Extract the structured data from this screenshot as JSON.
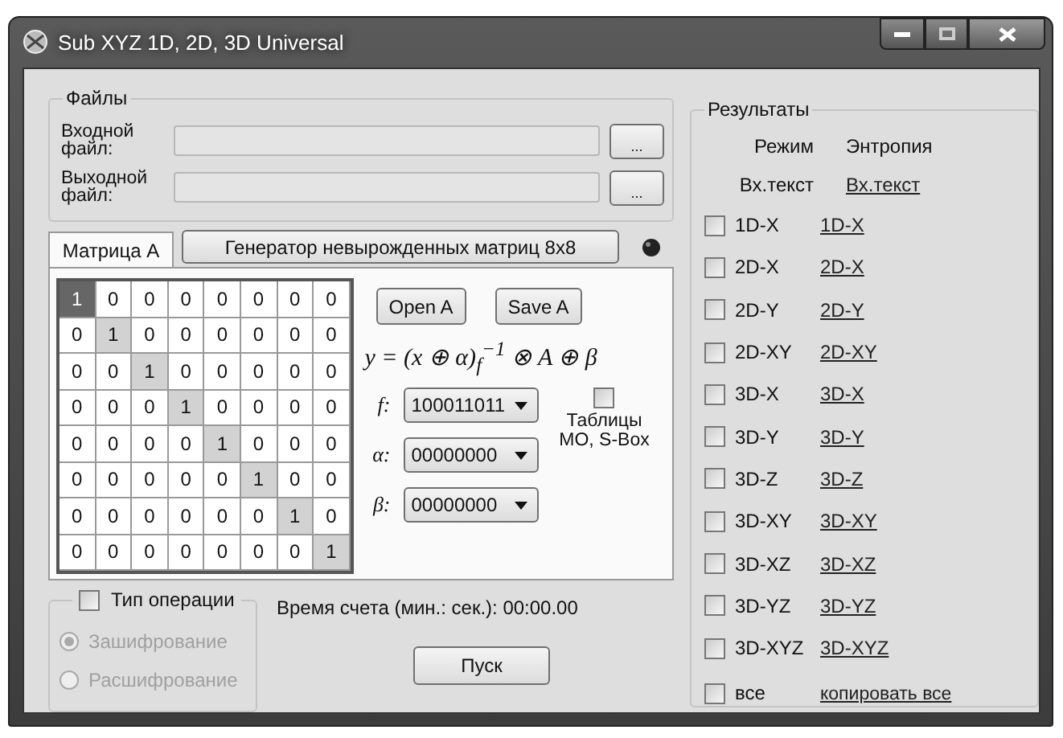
{
  "window": {
    "title": "Sub XYZ 1D, 2D, 3D Universal"
  },
  "files": {
    "title": "Файлы",
    "rows": [
      {
        "label": "Входной файл:",
        "browse": "..."
      },
      {
        "label": "Выходной файл:",
        "browse": "..."
      }
    ]
  },
  "tabs": [
    {
      "label": "Матрица А",
      "selected": true
    }
  ],
  "generator_button": "Генератор невырожденных матриц 8x8",
  "matrix": {
    "rows": [
      [
        {
          "value": "1",
          "selected": true,
          "marked": true
        },
        {
          "value": "0",
          "selected": false,
          "marked": false
        },
        {
          "value": "0",
          "selected": false,
          "marked": false
        },
        {
          "value": "0",
          "selected": false,
          "marked": false
        },
        {
          "value": "0",
          "selected": false,
          "marked": false
        },
        {
          "value": "0",
          "selected": false,
          "marked": false
        },
        {
          "value": "0",
          "selected": false,
          "marked": false
        },
        {
          "value": "0",
          "selected": false,
          "marked": false
        }
      ],
      [
        {
          "value": "0",
          "selected": false,
          "marked": false
        },
        {
          "value": "1",
          "selected": false,
          "marked": true
        },
        {
          "value": "0",
          "selected": false,
          "marked": false
        },
        {
          "value": "0",
          "selected": false,
          "marked": false
        },
        {
          "value": "0",
          "selected": false,
          "marked": false
        },
        {
          "value": "0",
          "selected": false,
          "marked": false
        },
        {
          "value": "0",
          "selected": false,
          "marked": false
        },
        {
          "value": "0",
          "selected": false,
          "marked": false
        }
      ],
      [
        {
          "value": "0",
          "selected": false,
          "marked": false
        },
        {
          "value": "0",
          "selected": false,
          "marked": false
        },
        {
          "value": "1",
          "selected": false,
          "marked": true
        },
        {
          "value": "0",
          "selected": false,
          "marked": false
        },
        {
          "value": "0",
          "selected": false,
          "marked": false
        },
        {
          "value": "0",
          "selected": false,
          "marked": false
        },
        {
          "value": "0",
          "selected": false,
          "marked": false
        },
        {
          "value": "0",
          "selected": false,
          "marked": false
        }
      ],
      [
        {
          "value": "0",
          "selected": false,
          "marked": false
        },
        {
          "value": "0",
          "selected": false,
          "marked": false
        },
        {
          "value": "0",
          "selected": false,
          "marked": false
        },
        {
          "value": "1",
          "selected": false,
          "marked": true
        },
        {
          "value": "0",
          "selected": false,
          "marked": false
        },
        {
          "value": "0",
          "selected": false,
          "marked": false
        },
        {
          "value": "0",
          "selected": false,
          "marked": false
        },
        {
          "value": "0",
          "selected": false,
          "marked": false
        }
      ],
      [
        {
          "value": "0",
          "selected": false,
          "marked": false
        },
        {
          "value": "0",
          "selected": false,
          "marked": false
        },
        {
          "value": "0",
          "selected": false,
          "marked": false
        },
        {
          "value": "0",
          "selected": false,
          "marked": false
        },
        {
          "value": "1",
          "selected": false,
          "marked": true
        },
        {
          "value": "0",
          "selected": false,
          "marked": false
        },
        {
          "value": "0",
          "selected": false,
          "marked": false
        },
        {
          "value": "0",
          "selected": false,
          "marked": false
        }
      ],
      [
        {
          "value": "0",
          "selected": false,
          "marked": false
        },
        {
          "value": "0",
          "selected": false,
          "marked": false
        },
        {
          "value": "0",
          "selected": false,
          "marked": false
        },
        {
          "value": "0",
          "selected": false,
          "marked": false
        },
        {
          "value": "0",
          "selected": false,
          "marked": false
        },
        {
          "value": "1",
          "selected": false,
          "marked": true
        },
        {
          "value": "0",
          "selected": false,
          "marked": false
        },
        {
          "value": "0",
          "selected": false,
          "marked": false
        }
      ],
      [
        {
          "value": "0",
          "selected": false,
          "marked": false
        },
        {
          "value": "0",
          "selected": false,
          "marked": false
        },
        {
          "value": "0",
          "selected": false,
          "marked": false
        },
        {
          "value": "0",
          "selected": false,
          "marked": false
        },
        {
          "value": "0",
          "selected": false,
          "marked": false
        },
        {
          "value": "0",
          "selected": false,
          "marked": false
        },
        {
          "value": "1",
          "selected": false,
          "marked": true
        },
        {
          "value": "0",
          "selected": false,
          "marked": false
        }
      ],
      [
        {
          "value": "0",
          "selected": false,
          "marked": false
        },
        {
          "value": "0",
          "selected": false,
          "marked": false
        },
        {
          "value": "0",
          "selected": false,
          "marked": false
        },
        {
          "value": "0",
          "selected": false,
          "marked": false
        },
        {
          "value": "0",
          "selected": false,
          "marked": false
        },
        {
          "value": "0",
          "selected": false,
          "marked": false
        },
        {
          "value": "0",
          "selected": false,
          "marked": false
        },
        {
          "value": "1",
          "selected": false,
          "marked": true
        }
      ]
    ]
  },
  "matrix_buttons": [
    "Open A",
    "Save A"
  ],
  "formula": "y = (x ⊕ α)$_{f}$$^{−1}$ ⊗ A ⊕ β",
  "params": [
    {
      "label": "f:",
      "value": "100011011"
    },
    {
      "label": "α:",
      "value": "00000000"
    },
    {
      "label": "β:",
      "value": "00000000"
    }
  ],
  "tables_option": {
    "label": "Таблицы MO, S-Box",
    "checked": false
  },
  "operation": {
    "label": "Тип операции",
    "checked": false,
    "options": [
      {
        "label": "Зашифрование",
        "selected": true,
        "disabled": true
      },
      {
        "label": "Расшифрование",
        "selected": false,
        "disabled": true
      }
    ]
  },
  "timer": "Время счета (мин.: сек.): 00:00.00",
  "start_button": "Пуск",
  "results": {
    "title": "Результаты",
    "headers": [
      "Режим",
      "Энтропия"
    ],
    "input_mode": "Вх.текст",
    "input_entropy": "Вх.текст",
    "rows": [
      {
        "mode": "1D-X",
        "entropy": "1D-X",
        "checked": false
      },
      {
        "mode": "2D-X",
        "entropy": "2D-X",
        "checked": false
      },
      {
        "mode": "2D-Y",
        "entropy": "2D-Y",
        "checked": false
      },
      {
        "mode": "2D-XY",
        "entropy": "2D-XY",
        "checked": false
      },
      {
        "mode": "3D-X",
        "entropy": "3D-X",
        "checked": false
      },
      {
        "mode": "3D-Y",
        "entropy": "3D-Y",
        "checked": false
      },
      {
        "mode": "3D-Z",
        "entropy": "3D-Z",
        "checked": false
      },
      {
        "mode": "3D-XY",
        "entropy": "3D-XY",
        "checked": false
      },
      {
        "mode": "3D-XZ",
        "entropy": "3D-XZ",
        "checked": false
      },
      {
        "mode": "3D-YZ",
        "entropy": "3D-YZ",
        "checked": false
      },
      {
        "mode": "3D-XYZ",
        "entropy": "3D-XYZ",
        "checked": false
      }
    ],
    "all": {
      "mode": "все",
      "entropy": "копировать все",
      "checked": false
    }
  }
}
